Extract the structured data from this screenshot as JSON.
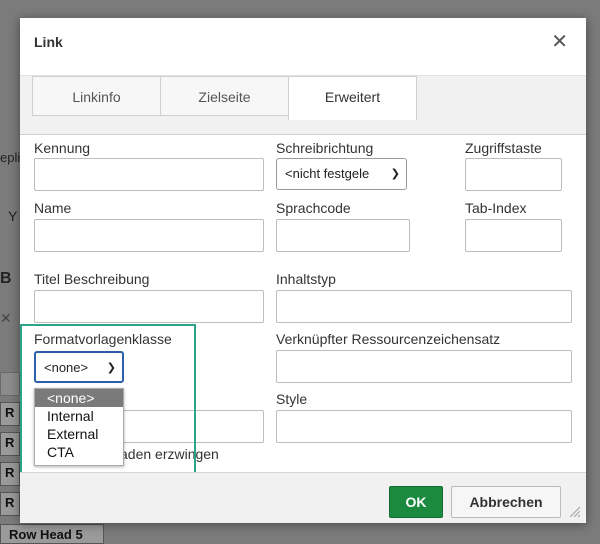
{
  "background": {
    "fragments": [
      "epli",
      "Y",
      "B",
      "R",
      "R",
      "R",
      "R"
    ],
    "row_head_label": "Row Head 5"
  },
  "dialog": {
    "title": "Link",
    "close_glyph": "✕",
    "tabs": [
      {
        "label": "Linkinfo"
      },
      {
        "label": "Zielseite"
      },
      {
        "label": "Erweitert"
      }
    ],
    "fields": {
      "kennung": {
        "label": "Kennung",
        "value": ""
      },
      "schreibrichtung": {
        "label": "Schreibrichtung",
        "selected": "<nicht festgele"
      },
      "zugriffstaste": {
        "label": "Zugriffstaste",
        "value": ""
      },
      "name": {
        "label": "Name",
        "value": ""
      },
      "sprachcode": {
        "label": "Sprachcode",
        "value": ""
      },
      "tab_index": {
        "label": "Tab-Index",
        "value": ""
      },
      "titel": {
        "label": "Titel Beschreibung",
        "value": ""
      },
      "inhaltstyp": {
        "label": "Inhaltstyp",
        "value": ""
      },
      "formatvorlagenklasse": {
        "label": "Formatvorlagenklasse",
        "selected": "<none>",
        "options": [
          "<none>",
          "Internal",
          "External",
          "CTA"
        ]
      },
      "ressourcen": {
        "label": "Verknüpfter Ressourcenzeichensatz",
        "value": ""
      },
      "style": {
        "label": "Style",
        "value": ""
      },
      "download_text": "aden erzwingen"
    },
    "buttons": {
      "ok": "OK",
      "cancel": "Abbrechen"
    }
  },
  "colors": {
    "ok_green": "#1b8a3f",
    "highlight_teal": "#2aa58a",
    "overlay": "#7b7b7b"
  }
}
